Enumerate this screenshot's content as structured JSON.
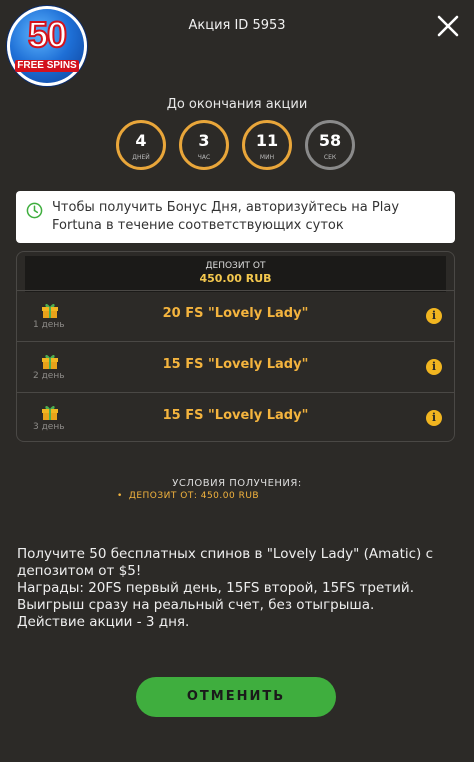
{
  "header": {
    "logo_number": "50",
    "logo_text": "FREE SPINS",
    "title": "Акция ID 5953"
  },
  "countdown": {
    "label": "До окончания акции",
    "cells": [
      {
        "value": "4",
        "unit": "ДНЕЙ"
      },
      {
        "value": "3",
        "unit": "ЧАС"
      },
      {
        "value": "11",
        "unit": "МИН"
      },
      {
        "value": "58",
        "unit": "СЕК"
      }
    ]
  },
  "notice": {
    "text": "Чтобы получить Бонус Дня, авторизуйтесь на Play Fortuna в течение соответствующих суток"
  },
  "deposit_table": {
    "header_label": "ДЕПОЗИТ ОТ",
    "header_value": "450.00 RUB",
    "rows": [
      {
        "day": "1 день",
        "prize": "20 FS \"Lovely Lady\""
      },
      {
        "day": "2 день",
        "prize": "15 FS \"Lovely Lady\""
      },
      {
        "day": "3 день",
        "prize": "15 FS \"Lovely Lady\""
      }
    ]
  },
  "conditions": {
    "title": "УСЛОВИЯ ПОЛУЧЕНИЯ:",
    "items": [
      "ДЕПОЗИТ ОТ: 450.00 RUB"
    ]
  },
  "description": "Получите 50 бесплатных спинов в \"Lovely Lady\" (Amatic) с депозитом от $5!\nНаграды: 20FS первый день, 15FS второй, 15FS третий. Выигрыш сразу на реальный счет, без отыгрыша. Действие акции - 3 дня.",
  "cancel_label": "ОТМЕНИТЬ",
  "colors": {
    "background": "#2c2a27",
    "accent": "#f4b43e",
    "timer_ring": "#e9a63a",
    "button": "#3fae3e"
  }
}
